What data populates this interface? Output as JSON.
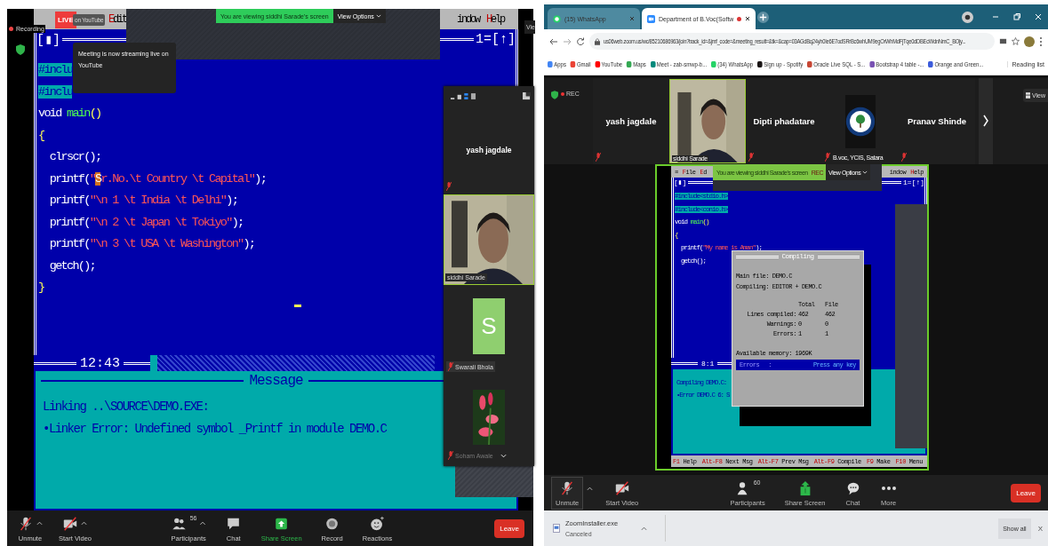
{
  "left_meeting": {
    "recording_label": "Recording",
    "live_badge": "LIVE",
    "live_destination": "on YouTube",
    "live_tooltip": "Meeting is now streaming live on YouTube",
    "share_banner": {
      "text": "You are viewing siddhi Sarade's screen",
      "options": "View Options"
    },
    "view_label": "Vie",
    "editor": {
      "menu_left": [
        {
          "label": "Edit",
          "hotkey": true
        }
      ],
      "menu_right": [
        {
          "label": "indow",
          "hotkey": false
        },
        {
          "label": "Help",
          "hotkey": true
        }
      ],
      "close_box": "[▮]",
      "window_number": "1",
      "zoom_box": "=[↑]",
      "code": [
        [
          {
            "t": "#inclu",
            "kind": "selected"
          }
        ],
        [
          {
            "t": "#inclu",
            "kind": "selected"
          }
        ],
        [
          {
            "t": "void ",
            "kind": "plain"
          },
          {
            "t": "main",
            "kind": "func"
          },
          {
            "t": "()",
            "kind": "punct"
          }
        ],
        [
          {
            "t": "{",
            "kind": "punct"
          }
        ],
        [
          {
            "t": "  clrscr();",
            "kind": "plain"
          }
        ],
        [
          {
            "t": "  printf(",
            "kind": "plain"
          },
          {
            "t": "\"",
            "kind": "string"
          },
          {
            "t": "S",
            "kind": "cursor"
          },
          {
            "t": "r.No.\\t Country \\t Capital\"",
            "kind": "string"
          },
          {
            "t": ");",
            "kind": "plain"
          }
        ],
        [
          {
            "t": "  printf(",
            "kind": "plain"
          },
          {
            "t": "\"\\n 1 \\t India \\t Delhi\"",
            "kind": "string"
          },
          {
            "t": ");",
            "kind": "plain"
          }
        ],
        [
          {
            "t": "  printf(",
            "kind": "plain"
          },
          {
            "t": "\"\\n 2 \\t Japan \\t Tokiyo\"",
            "kind": "string"
          },
          {
            "t": ");",
            "kind": "plain"
          }
        ],
        [
          {
            "t": "  printf(",
            "kind": "plain"
          },
          {
            "t": "\"\\n 3 \\t USA \\t Washington\"",
            "kind": "string"
          },
          {
            "t": ");",
            "kind": "plain"
          }
        ],
        [
          {
            "t": "  getch();",
            "kind": "plain"
          }
        ],
        [
          {
            "t": "}",
            "kind": "punct"
          }
        ]
      ],
      "position": "12:43",
      "message_title": "Message",
      "messages": [
        "Linking ..\\SOURCE\\DEMO.EXE:",
        "•Linker Error: Undefined symbol _Printf in module DEMO.C"
      ]
    },
    "gallery": [
      {
        "name": "yash jagdale",
        "kind": "name",
        "muted": true
      },
      {
        "name": "siddhi Sarade",
        "kind": "video",
        "muted": false
      },
      {
        "name": "Swarali Bhola",
        "kind": "initial",
        "initial": "S",
        "muted": true
      },
      {
        "name": "Soham Awale",
        "kind": "picture",
        "muted": true
      }
    ],
    "toolbar_left": [
      {
        "label": "Unmute",
        "kind": "mic",
        "caret": true
      },
      {
        "label": "Start Video",
        "kind": "video",
        "caret": true
      }
    ],
    "toolbar_center": [
      {
        "label": "Participants",
        "kind": "participants",
        "count": "56",
        "caret": true
      },
      {
        "label": "Chat",
        "kind": "chat",
        "caret": false
      },
      {
        "label": "Share Screen",
        "kind": "share",
        "caret": false
      },
      {
        "label": "Record",
        "kind": "record",
        "caret": false
      },
      {
        "label": "Reactions",
        "kind": "reactions",
        "caret": false
      }
    ],
    "leave": "Leave"
  },
  "browser": {
    "tabs": [
      {
        "title": "(15) WhatsApp",
        "kind": "whatsapp",
        "selected": false
      },
      {
        "title": "Department of B.Voc(Softw",
        "kind": "zoom",
        "selected": true
      }
    ],
    "address": "us06web.zoom.us/wc/85210686963/join?track_id=&jmf_code=&meeting_result=&tk=&cap=03AGdBq24yh0Ie6E7odSRrBc6whUM9egOrWhMdFjTqe0dDBEcWdnNmC_BOjy...",
    "bookmarks": [
      {
        "label": "Apps",
        "color": "#4285f4"
      },
      {
        "label": "Gmail",
        "color": "#ea4335"
      },
      {
        "label": "YouTube",
        "color": "#ff0000"
      },
      {
        "label": "Maps",
        "color": "#34a853"
      },
      {
        "label": "Meet - zab-smwp-b...",
        "color": "#00897b"
      },
      {
        "label": "(34) WhatsApp",
        "color": "#25d366"
      },
      {
        "label": "Sign up - Spotify",
        "color": "#191414"
      },
      {
        "label": "Oracle Live SQL - S...",
        "color": "#c74634"
      },
      {
        "label": "Bootstrap 4 table -...",
        "color": "#7952b3"
      },
      {
        "label": "Orange and Green...",
        "color": "#3b5bdb"
      }
    ],
    "reading_list": "Reading list"
  },
  "right_meeting": {
    "rec": "REC",
    "strip": [
      {
        "name": "yash jagdale",
        "kind": "name",
        "muted": true
      },
      {
        "name": "siddhi Sarade",
        "kind": "video",
        "muted": false
      },
      {
        "name": "Dipti phadatare",
        "kind": "name",
        "muted": true
      },
      {
        "name": "B.voc, YCIS, Satara",
        "kind": "logo",
        "muted": true
      },
      {
        "name": "Pranav Shinde",
        "kind": "name",
        "muted": true
      }
    ],
    "view_label": "View",
    "share_banner": {
      "text": "You are viewing siddhi Sarade's screen",
      "rec": "REC",
      "options": "View Options"
    },
    "editor": {
      "menu_left": [
        {
          "label": "≡",
          "hotkey": false
        },
        {
          "label": "File",
          "hotkey": true
        },
        {
          "label": "Ed",
          "hotkey": true
        }
      ],
      "menu_right": [
        {
          "label": "indow",
          "hotkey": false
        },
        {
          "label": "Help",
          "hotkey": true
        }
      ],
      "close_box": "[▮]",
      "window_number": "1",
      "zoom_box": "=[↑]",
      "code": [
        [
          {
            "t": "#include<stdio.h>",
            "kind": "selected"
          }
        ],
        [
          {
            "t": "#include<conio.h>",
            "kind": "selected"
          }
        ],
        [
          {
            "t": "void ",
            "kind": "plain"
          },
          {
            "t": "main",
            "kind": "func"
          },
          {
            "t": "()",
            "kind": "punct"
          }
        ],
        [
          {
            "t": "{",
            "kind": "punct"
          }
        ],
        [
          {
            "t": "  printf(",
            "kind": "plain"
          },
          {
            "t": "\"My name is Aman\"",
            "kind": "string"
          },
          {
            "t": ");",
            "kind": "plain"
          }
        ],
        [
          {
            "t": "  getch();",
            "kind": "plain"
          }
        ]
      ],
      "position": "8:1",
      "dialog": {
        "title": "Compiling",
        "main_file": "Main file: DEMO.C",
        "compiling": "Compiling: EDITOR + DEMO.C",
        "columns": [
          "Total",
          "File"
        ],
        "rows": [
          {
            "label": "Lines compiled:",
            "total": "462",
            "file": "462"
          },
          {
            "label": "Warnings:",
            "total": "0",
            "file": "0"
          },
          {
            "label": "Errors:",
            "total": "1",
            "file": "1"
          }
        ],
        "memory": "Available memory: 1969K",
        "status": "Errors",
        "separator": ":",
        "prompt": "Press any key"
      },
      "messages": [
        "Compiling DEMO.C:",
        "•Error DEMO.C 6: S"
      ],
      "keys": [
        {
          "key": "F1",
          "action": "Help"
        },
        {
          "key": "Alt-F8",
          "action": "Next Msg"
        },
        {
          "key": "Alt-F7",
          "action": "Prev Msg"
        },
        {
          "key": "Alt-F9",
          "action": "Compile"
        },
        {
          "key": "F9",
          "action": "Make"
        },
        {
          "key": "F10",
          "action": "Menu"
        }
      ]
    },
    "toolbar_left": [
      {
        "label": "Unmute",
        "kind": "mic",
        "caret": true,
        "selected": true
      },
      {
        "label": "Start Video",
        "kind": "video",
        "caret": false,
        "selected": false
      }
    ],
    "toolbar_center": [
      {
        "label": "Participants",
        "kind": "participants",
        "count": "60"
      },
      {
        "label": "Share Screen",
        "kind": "share"
      },
      {
        "label": "Chat",
        "kind": "chat"
      },
      {
        "label": "More",
        "kind": "more"
      }
    ],
    "leave": "Leave"
  },
  "downloads": {
    "file": "ZoomInstaller.exe",
    "status": "Canceled",
    "show_all": "Show all",
    "close": "X"
  }
}
